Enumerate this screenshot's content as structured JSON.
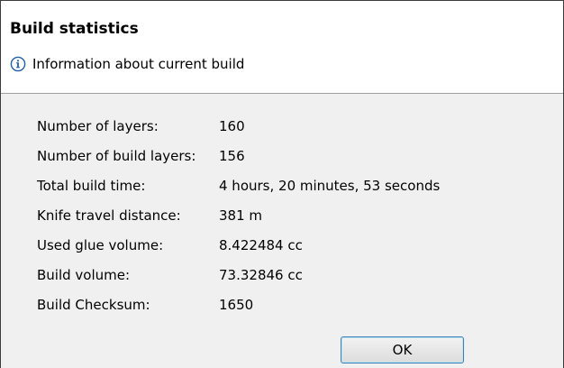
{
  "dialog": {
    "title": "Build statistics",
    "info_icon": "info-circle-icon",
    "info_text": "Information about current build"
  },
  "stats": [
    {
      "label": "Number of layers:",
      "value": "160"
    },
    {
      "label": "Number of build layers:",
      "value": "156"
    },
    {
      "label": "Total build time:",
      "value": "4 hours, 20 minutes, 53 seconds"
    },
    {
      "label": "Knife travel distance:",
      "value": "381 m"
    },
    {
      "label": "Used glue volume:",
      "value": "8.422484 cc"
    },
    {
      "label": "Build volume:",
      "value": "73.32846 cc"
    },
    {
      "label": "Build Checksum:",
      "value": "1650"
    }
  ],
  "buttons": {
    "ok_label": "OK"
  },
  "colors": {
    "info_icon": "#1f5fa6",
    "panel_background": "#f0f0f0",
    "header_background": "#ffffff",
    "button_border": "#3c7fb1"
  }
}
